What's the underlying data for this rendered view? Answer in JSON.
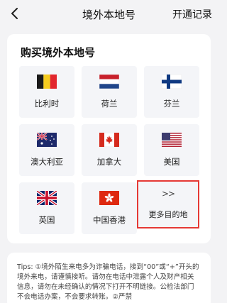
{
  "header": {
    "title": "境外本地号",
    "right_link": "开通记录",
    "back_icon": "chevron-left-icon"
  },
  "section": {
    "title": "购买境外本地号"
  },
  "countries": [
    {
      "name": "比利时",
      "flag": "belgium-flag-icon"
    },
    {
      "name": "荷兰",
      "flag": "netherlands-flag-icon"
    },
    {
      "name": "芬兰",
      "flag": "finland-flag-icon"
    },
    {
      "name": "澳大利亚",
      "flag": "australia-flag-icon"
    },
    {
      "name": "加拿大",
      "flag": "canada-flag-icon"
    },
    {
      "name": "美国",
      "flag": "usa-flag-icon"
    },
    {
      "name": "英国",
      "flag": "uk-flag-icon"
    },
    {
      "name": "中国香港",
      "flag": "hong-kong-flag-icon"
    }
  ],
  "more": {
    "chevrons": ">>",
    "label": "更多目的地"
  },
  "tips": {
    "text": "Tips: ①境外陌生来电多为诈骗电话，接到“00”或“+”开头的境外来电，请谨慎接听。请勿在电话中泄露个人及财产相关信息，请勿在未经确认的情况下打开不明链接。公检法部门不会电话办案，不会要求转账。②严禁"
  },
  "colors": {
    "highlight": "#e53935",
    "tile_bg": "#f4f5f8",
    "page_bg": "#f3f3f5"
  }
}
